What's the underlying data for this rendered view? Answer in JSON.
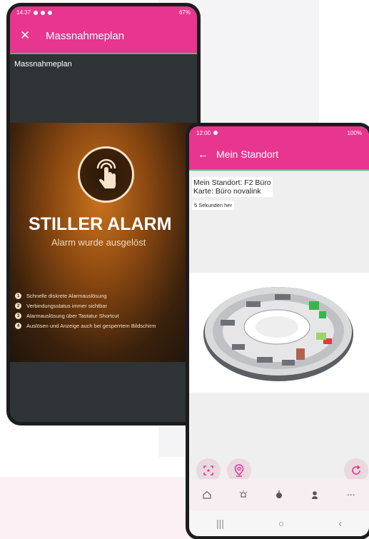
{
  "phone1": {
    "status_time": "14:37",
    "status_right": "67%",
    "appbar_title": "Massnahmeplan",
    "subtitle": "Massnahmeplan",
    "alarm": {
      "title": "STILLER ALARM",
      "subtitle": "Alarm wurde ausgelöst",
      "features": [
        {
          "num": "1",
          "text": "Schnelle diskrete Alarmauslösung"
        },
        {
          "num": "2",
          "text": "Verbindungsstatus immer sichtbar"
        },
        {
          "num": "3",
          "text": "Alarmauslösung über Tastatur Shortcut"
        },
        {
          "num": "4",
          "text": "Auslösen und Anzeige auch bei gesperrtem Bildschirm"
        }
      ]
    }
  },
  "phone2": {
    "status_time": "12:00",
    "status_right": "100%",
    "appbar_title": "Mein Standort",
    "location_line1": "Mein Standort: F2 Büro",
    "location_line2": "Karte: Büro novalink",
    "time_ago": "5 Sekunden her"
  },
  "colors": {
    "brand_pink": "#e8358f",
    "accent_green": "#2ecc71"
  }
}
